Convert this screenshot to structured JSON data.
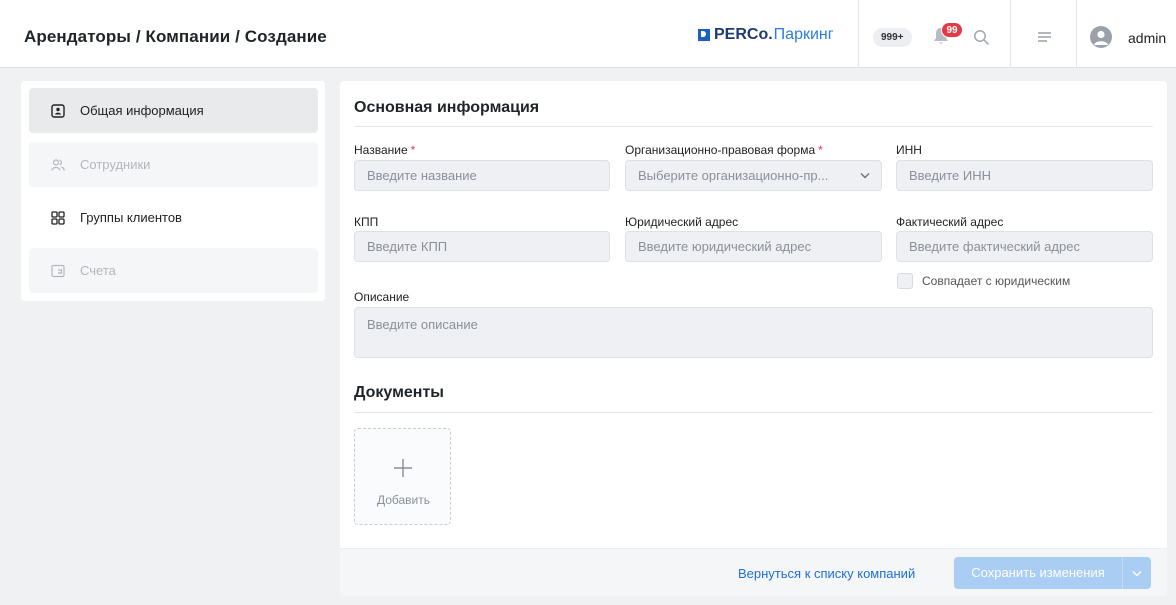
{
  "header": {
    "breadcrumb": "Арендаторы / Компании / Создание",
    "logo_brand": "PERCo.",
    "logo_product": "Паркинг",
    "counter_badge": "999+",
    "notifications_count": "99",
    "username": "admin"
  },
  "sidebar": {
    "items": [
      {
        "label": "Общая информация",
        "state": "active",
        "icon": "id-card-icon"
      },
      {
        "label": "Сотрудники",
        "state": "disabled",
        "icon": "users-icon"
      },
      {
        "label": "Группы клиентов",
        "state": "normal",
        "icon": "grid-icon"
      },
      {
        "label": "Счета",
        "state": "disabled",
        "icon": "wallet-icon"
      }
    ]
  },
  "form": {
    "section_basic": "Основная информация",
    "name_label": "Название",
    "name_placeholder": "Введите название",
    "legal_form_label": "Организационно-правовая форма",
    "legal_form_placeholder": "Выберите организационно-пр...",
    "inn_label": "ИНН",
    "inn_placeholder": "Введите ИНН",
    "kpp_label": "КПП",
    "kpp_placeholder": "Введите КПП",
    "legal_address_label": "Юридический адрес",
    "legal_address_placeholder": "Введите юридический адрес",
    "actual_address_label": "Фактический адрес",
    "actual_address_placeholder": "Введите фактический адрес",
    "same_as_legal_label": "Совпадает с юридическим",
    "description_label": "Описание",
    "description_placeholder": "Введите описание",
    "required_mark": "*"
  },
  "documents": {
    "title": "Документы",
    "add_label": "Добавить"
  },
  "footer": {
    "back_link": "Вернуться к списку компаний",
    "save_label": "Сохранить изменения"
  },
  "colors": {
    "accent": "#1f6fd6",
    "save_disabled": "#a9cdf3",
    "notification": "#e53945"
  }
}
